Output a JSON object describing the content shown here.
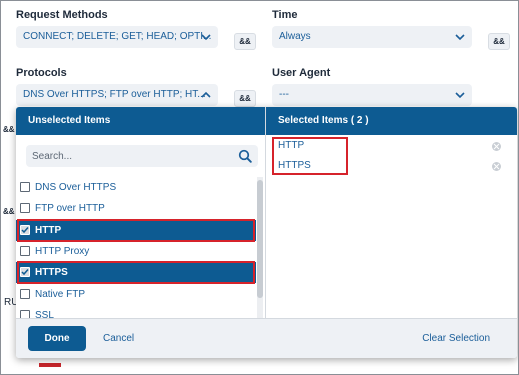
{
  "form": {
    "request_methods": {
      "label": "Request Methods",
      "value": "CONNECT; DELETE; GET; HEAD; OPTI...",
      "and": "&&"
    },
    "time": {
      "label": "Time",
      "value": "Always",
      "and": "&&"
    },
    "protocols": {
      "label": "Protocols",
      "value": "DNS Over HTTPS; FTP over HTTP; HT...",
      "and": "&&"
    },
    "user_agent": {
      "label": "User Agent",
      "value": "---"
    },
    "behind_fragments": {
      "and_1": "&&",
      "and_2": "&&",
      "ru": "RU"
    }
  },
  "dropdown": {
    "unselected_header": "Unselected Items",
    "selected_header": "Selected Items ( 2 )",
    "search_placeholder": "Search...",
    "items": [
      {
        "label": "DNS Over HTTPS",
        "checked": false
      },
      {
        "label": "FTP over HTTP",
        "checked": false
      },
      {
        "label": "HTTP",
        "checked": true
      },
      {
        "label": "HTTP Proxy",
        "checked": false
      },
      {
        "label": "HTTPS",
        "checked": true
      },
      {
        "label": "Native FTP",
        "checked": false
      },
      {
        "label": "SSL",
        "checked": false
      }
    ],
    "selected_items": [
      "HTTP",
      "HTTPS"
    ],
    "footer": {
      "done": "Done",
      "cancel": "Cancel",
      "clear": "Clear Selection"
    }
  },
  "colors": {
    "primary": "#0d5b92",
    "link": "#1b5e99",
    "highlight": "#d6232b",
    "field_bg": "#eef1f5"
  }
}
